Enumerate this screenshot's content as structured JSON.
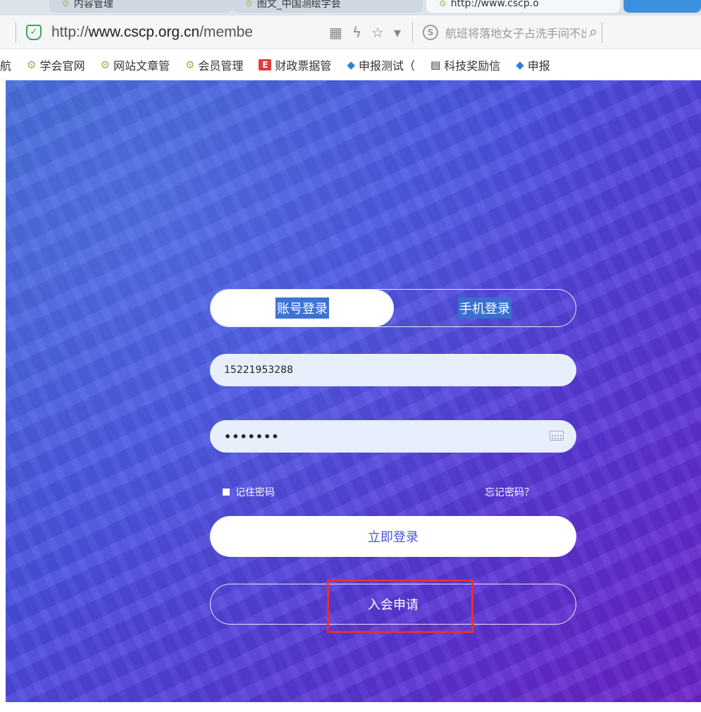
{
  "browser": {
    "tabs": [
      {
        "label": "内容管理"
      },
      {
        "label": "图文_中国测绘学会"
      },
      {
        "label": "http://www.cscp.o"
      },
      {
        "label": ""
      }
    ],
    "address": {
      "url_prefix": "http://",
      "url_host": "www.cscp.org.cn",
      "url_path": "/membe",
      "search_text": "航班将落地女子占洗手间不出来"
    },
    "bookmarks": [
      {
        "label": "航",
        "icon": "none"
      },
      {
        "label": "学会官网",
        "icon": "cns-icon"
      },
      {
        "label": "网站文章管",
        "icon": "cns-icon"
      },
      {
        "label": "会员管理",
        "icon": "cns-icon"
      },
      {
        "label": "财政票据管",
        "icon": "red-e-icon"
      },
      {
        "label": "申报测试（",
        "icon": "blue-diamond-icon"
      },
      {
        "label": "科技奖励信",
        "icon": "document-icon"
      },
      {
        "label": "申报",
        "icon": "blue-diamond-icon"
      }
    ]
  },
  "login": {
    "tab_account": "账号登录",
    "tab_phone": "手机登录",
    "username_value": "15221953288",
    "password_value": "•••••••",
    "remember_label": "记住密码",
    "forgot_label": "忘记密码？",
    "login_button": "立即登录",
    "join_button": "入会申请"
  },
  "colors": {
    "accent": "#4a55d8",
    "gradient_start": "#3f64d6",
    "gradient_end": "#6c22c9",
    "highlight": "#e53030"
  }
}
